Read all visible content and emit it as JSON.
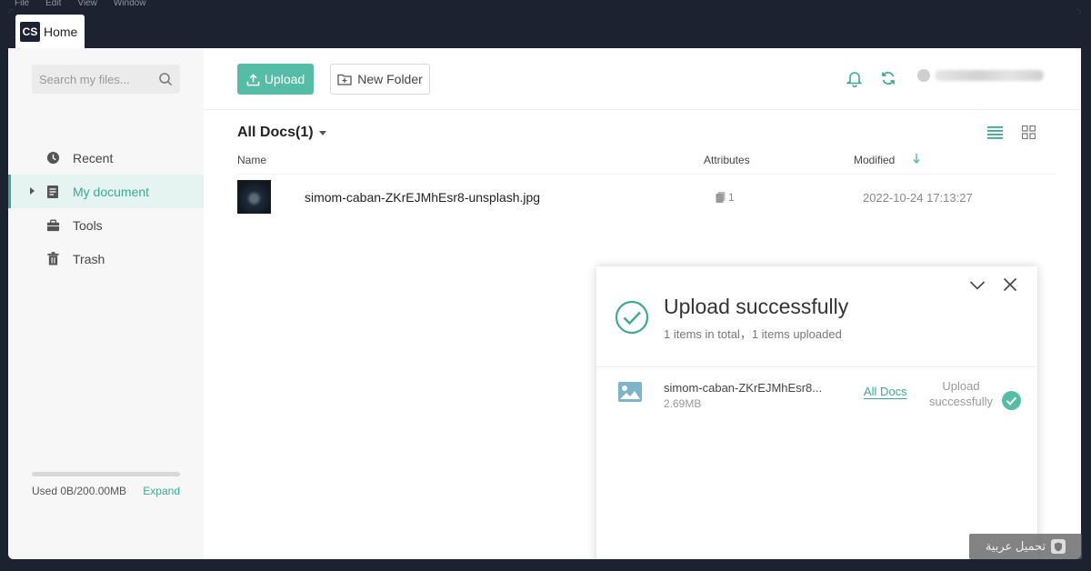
{
  "menubar": {
    "items": [
      "File",
      "Edit",
      "View",
      "Window"
    ]
  },
  "tab": {
    "logo": "CS",
    "label": "Home"
  },
  "sidebar": {
    "search_placeholder": "Search my files...",
    "items": [
      {
        "label": "Recent",
        "icon": "clock-icon"
      },
      {
        "label": "My document",
        "icon": "document-icon",
        "active": true
      },
      {
        "label": "Tools",
        "icon": "briefcase-icon"
      },
      {
        "label": "Trash",
        "icon": "trash-icon"
      }
    ],
    "storage": {
      "used": "Used 0B/200.00MB",
      "expand": "Expand",
      "fraction": 0
    }
  },
  "toolbar": {
    "upload_label": "Upload",
    "new_folder_label": "New Folder"
  },
  "docs": {
    "title": "All Docs(1)",
    "columns": {
      "name": "Name",
      "attributes": "Attributes",
      "modified": "Modified"
    },
    "rows": [
      {
        "name": "simom-caban-ZKrEJMhEsr8-unsplash.jpg",
        "attr_count": "1",
        "modified": "2022-10-24 17:13:27"
      }
    ]
  },
  "upload_panel": {
    "title": "Upload successfully",
    "subtitle": "1 items in total，1 items uploaded",
    "item": {
      "name": "simom-caban-ZKrEJMhEsr8...",
      "size": "2.69MB",
      "location": "All Docs",
      "status_line1": "Upload",
      "status_line2": "successfully"
    }
  },
  "watermark": {
    "text": "تحميل عربية"
  },
  "colors": {
    "accent": "#55bda6",
    "dark": "#1c2230"
  }
}
